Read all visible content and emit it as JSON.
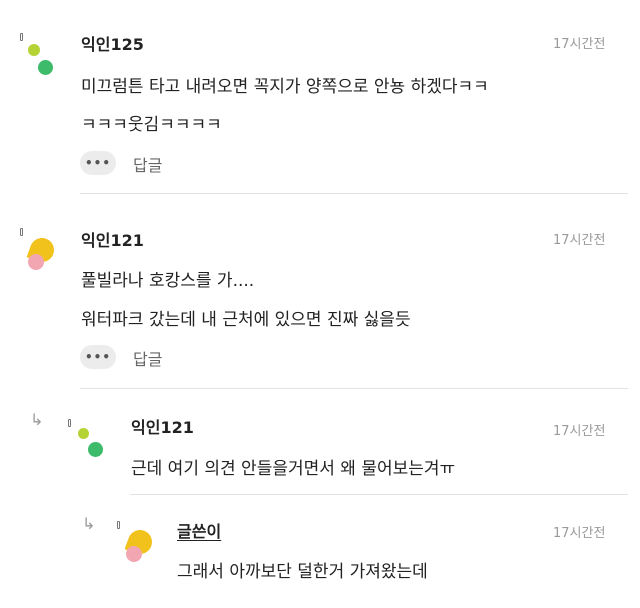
{
  "comments": [
    {
      "author": "익인125",
      "time": "17시간전",
      "lines": [
        "미끄럼튼 타고 내려오면 꼭지가 양쪽으로 안뇽 하겠다ㅋㅋ",
        "ㅋㅋㅋ웃김ㅋㅋㅋㅋ"
      ],
      "reply_label": "답글",
      "more_label": "•••"
    },
    {
      "author": "익인121",
      "time": "17시간전",
      "lines": [
        "풀빌라나 호캉스를 가....",
        "워터파크 갔는데 내 근처에 있으면 진짜 싫을듯"
      ],
      "reply_label": "답글",
      "more_label": "•••"
    },
    {
      "author": "익인121",
      "time": "17시간전",
      "lines": [
        "근데 여기 의견 안들을거면서 왜 물어보는겨ㅠ"
      ]
    },
    {
      "author": "글쓴이",
      "time": "17시간전",
      "lines": [
        "그래서 아까보단 덜한거 가져왔는데"
      ]
    }
  ],
  "icons": {
    "avatar_green_dots": "avatar-green-dots",
    "avatar_yellow_pink": "avatar-yellow-pink",
    "reply_arrow": "reply-arrow"
  },
  "colors": {
    "lime": "#b5d334",
    "green": "#3dbb6a",
    "yellow": "#f2c21c",
    "pink": "#f2a6b2"
  }
}
